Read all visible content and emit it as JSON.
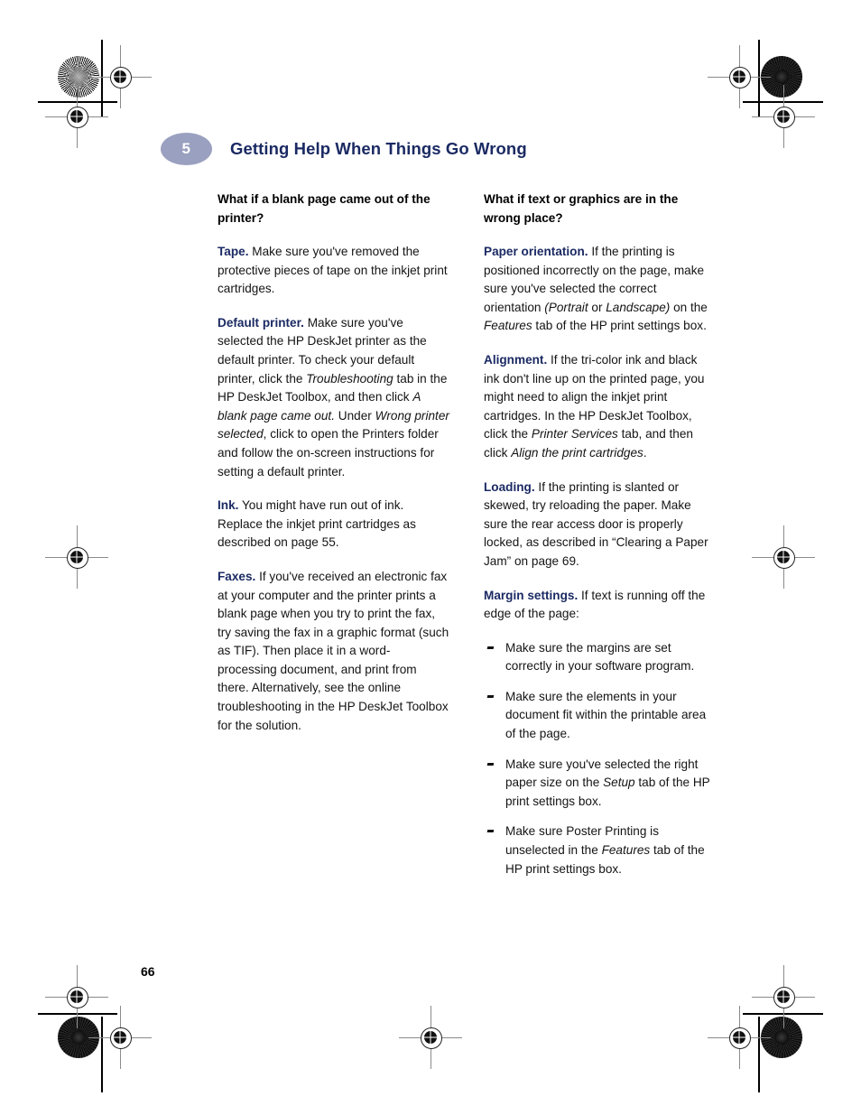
{
  "page": {
    "folio": "66",
    "chapter_number": "5",
    "chapter_title": "Getting Help When Things Go Wrong",
    "badge_color": "#9aa0bf",
    "heading_color": "#1b2a63",
    "lead_in_color": "#1b2a63",
    "body_color": "#141414"
  },
  "left_column": {
    "question": "What if a blank page came out of the printer?",
    "paragraphs": [
      {
        "lead": "Tape.",
        "rest": " Make sure you've removed the protective pieces of tape on the inkjet print cartridges."
      },
      {
        "lead": "Default printer.",
        "rest_1": " Make sure you've selected the HP DeskJet printer as the default printer. To check your default printer, click the  ",
        "italic_1": "Troubleshooting",
        "rest_2": " tab in the HP DeskJet Toolbox, and then click ",
        "italic_2": "A blank page came out.",
        "rest_3": " Under ",
        "italic_3": "Wrong printer selected",
        "rest_4": ", click to open the Printers folder and follow the on-screen instructions for setting a default printer."
      },
      {
        "lead": "Ink.",
        "rest": " You might have run out of ink. Replace the inkjet print cartridges as described on page 55."
      },
      {
        "lead": "Faxes.",
        "rest": " If you've received an electronic fax at your computer and the printer prints a blank page when you try to print the fax, try saving the fax in a graphic format (such as TIF). Then place it in a word-processing document, and print from there. Alternatively, see the online troubleshooting in the HP DeskJet Toolbox for the solution."
      }
    ]
  },
  "right_column": {
    "question": "What if text or graphics are in the wrong place?",
    "paragraphs": [
      {
        "lead": "Paper orientation.",
        "rest_1": " If the printing is positioned incorrectly on the page, make sure you've selected the correct orientation ",
        "italic_1": "(Portrait",
        "rest_2": " or ",
        "italic_2": "Landscape)",
        "rest_3": " on the ",
        "italic_3": "Features",
        "rest_4": " tab of the HP print settings box."
      },
      {
        "lead": "Alignment.",
        "rest_1": " If the tri-color ink and black ink don't line up on the printed page, you might need to align the inkjet print cartridges. In the HP DeskJet Toolbox, click the ",
        "italic_1": "Printer Services",
        "rest_2": " tab, and then click ",
        "italic_2": "Align the print cartridges",
        "rest_3": "."
      },
      {
        "lead": "Loading.",
        "rest": " If the printing is slanted or skewed, try reloading the paper. Make sure the rear access door is properly locked, as described in “Clearing a Paper Jam” on page 69."
      },
      {
        "lead": "Margin settings.",
        "rest": " If text is running off the edge of the page:"
      }
    ],
    "bullets": [
      {
        "text_1": "Make sure the margins are set correctly in your software program.",
        "italic_1": "",
        "text_2": ""
      },
      {
        "text_1": "Make sure the elements in your document fit within the printable area of the page.",
        "italic_1": "",
        "text_2": ""
      },
      {
        "text_1": "Make sure you've selected the right paper size on the ",
        "italic_1": "Setup",
        "text_2": " tab of the HP print settings box."
      },
      {
        "text_1": "Make sure Poster Printing is unselected in the ",
        "italic_1": "Features",
        "text_2": " tab of the HP print settings box."
      }
    ]
  },
  "prepress_marks": {
    "star_targets": "halftone-star-target",
    "registration_targets": "registration-crosshair",
    "trim_rules": "trim-rule-line"
  }
}
